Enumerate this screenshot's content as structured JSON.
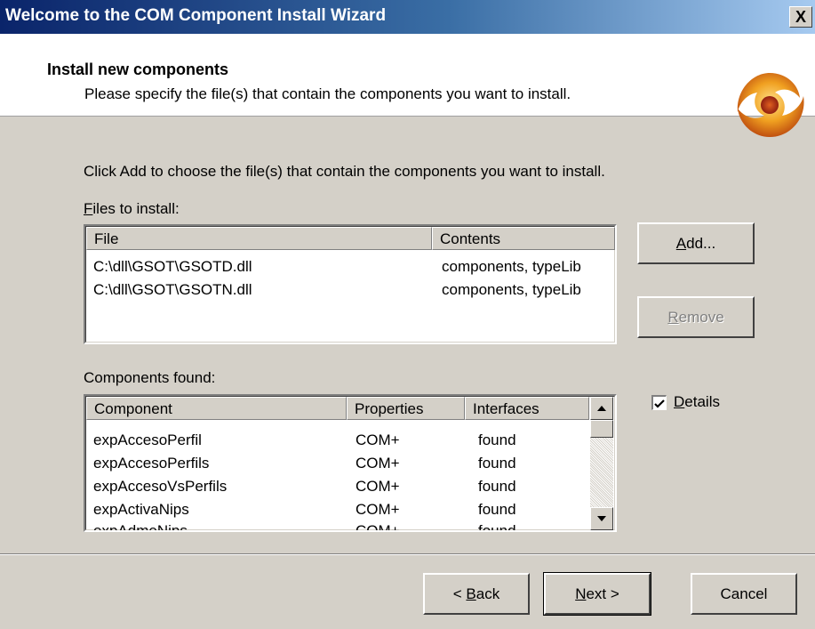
{
  "window": {
    "title": "Welcome to the COM Component Install Wizard",
    "close_label": "X"
  },
  "header": {
    "title": "Install new components",
    "subtitle": "Please specify the file(s) that contain the components you want to install."
  },
  "instructions": "Click Add to choose the file(s) that contain the components you want to install.",
  "files": {
    "label_accel": "F",
    "label_rest": "iles to install:",
    "columns": [
      "File",
      "Contents"
    ],
    "rows": [
      {
        "file": "C:\\dll\\GSOT\\GSOTD.dll",
        "contents": "components, typeLib"
      },
      {
        "file": "C:\\dll\\GSOT\\GSOTN.dll",
        "contents": "components, typeLib"
      }
    ]
  },
  "buttons": {
    "add_accel": "A",
    "add_rest": "dd...",
    "remove_accel": "R",
    "remove_rest": "emove",
    "back_pre": "< ",
    "back_accel": "B",
    "back_rest": "ack",
    "next_accel": "N",
    "next_rest": "ext >",
    "cancel": "Cancel"
  },
  "components": {
    "label": "Components found:",
    "columns": [
      "Component",
      "Properties",
      "Interfaces"
    ],
    "rows": [
      {
        "component": "expAccesoPerfil",
        "properties": "COM+",
        "interfaces": "found"
      },
      {
        "component": "expAccesoPerfils",
        "properties": "COM+",
        "interfaces": "found"
      },
      {
        "component": "expAccesoVsPerfils",
        "properties": "COM+",
        "interfaces": "found"
      },
      {
        "component": "expActivaNips",
        "properties": "COM+",
        "interfaces": "found"
      },
      {
        "component": "expAdmeNips",
        "properties": "COM+",
        "interfaces": "found"
      }
    ]
  },
  "details": {
    "checked": true,
    "label_accel": "D",
    "label_rest": "etails"
  }
}
